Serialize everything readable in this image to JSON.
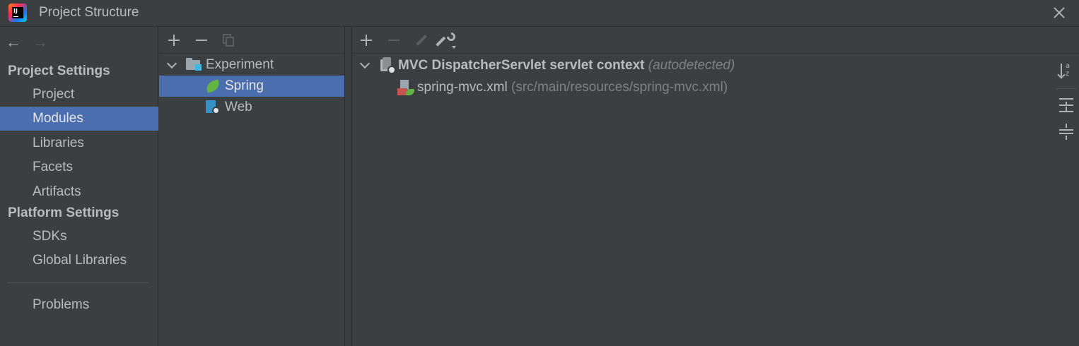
{
  "window": {
    "title": "Project Structure",
    "app_icon_text": "IJ"
  },
  "nav": {
    "back_icon": "←",
    "forward_icon": "→",
    "project_settings_header": "Project Settings",
    "platform_settings_header": "Platform Settings",
    "items": {
      "project": "Project",
      "modules": "Modules",
      "libraries": "Libraries",
      "facets": "Facets",
      "artifacts": "Artifacts",
      "sdks": "SDKs",
      "global_libraries": "Global Libraries",
      "problems": "Problems"
    },
    "selected": "Modules"
  },
  "module_tree": {
    "root": "Experiment",
    "children": [
      "Spring",
      "Web"
    ],
    "selected": "Spring"
  },
  "spring_panel": {
    "context_label": "MVC DispatcherServlet servlet context",
    "context_note": "(autodetected)",
    "file_name": "spring-mvc.xml",
    "file_path": "(src/main/resources/spring-mvc.xml)",
    "sort_icon_text": "a\nz"
  },
  "colors": {
    "background": "#3c3f41",
    "selection": "#4b6eaf",
    "text": "#bbbbbb",
    "muted_text": "#808080",
    "spring_green": "#62b543"
  }
}
